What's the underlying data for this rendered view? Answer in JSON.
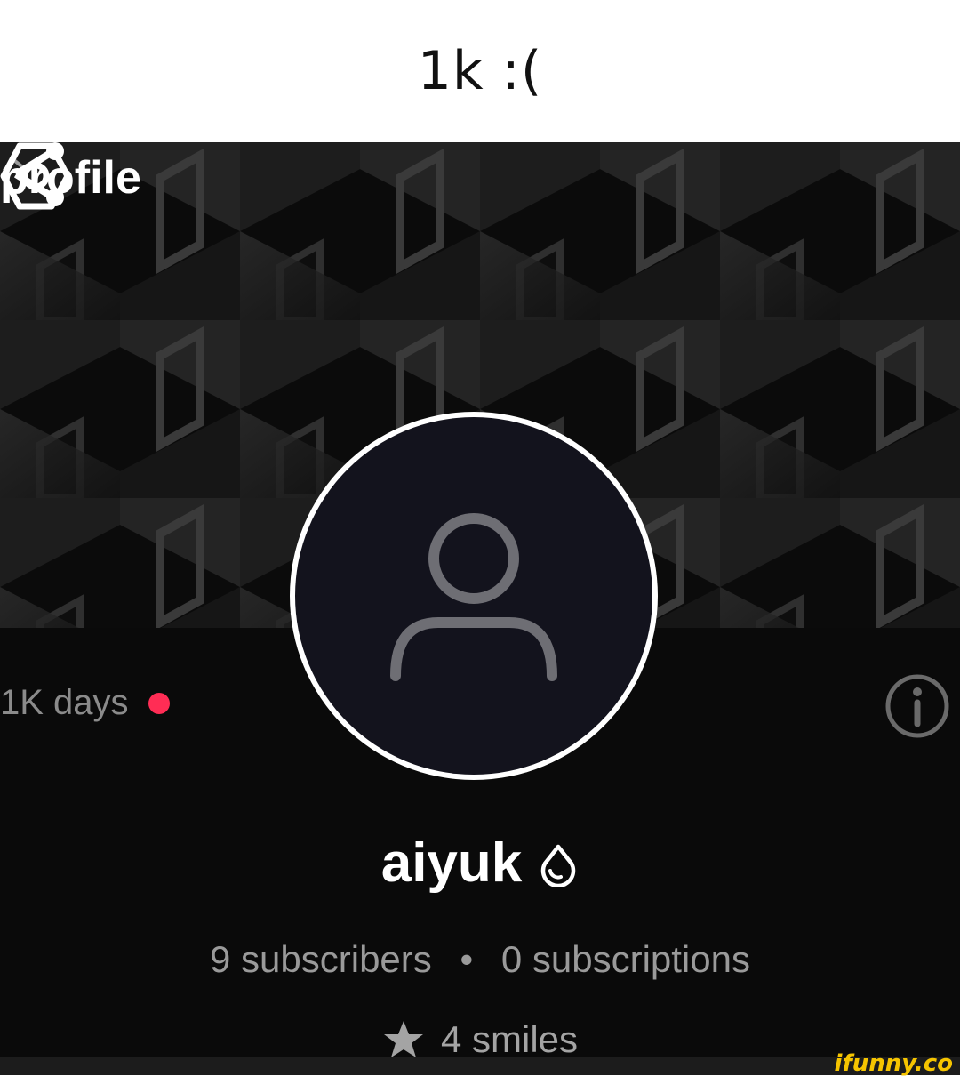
{
  "caption": {
    "text": "1k :("
  },
  "header": {
    "title": "profile"
  },
  "stats_row": {
    "days": "1K days",
    "username": "aiyuk",
    "subscribers": "9 subscribers",
    "separator": "•",
    "subscriptions": "0 subscriptions",
    "smiles": "4 smiles"
  },
  "colors": {
    "background": "#0a0a0a",
    "status_dot": "#ff2d55",
    "avatar_bg": "#13131d",
    "watermark": "#f5c400"
  },
  "icons": {
    "title_dropdown": "chevron-down-icon",
    "share": "share-icon",
    "settings": "settings-icon",
    "avatar": "user-placeholder-icon",
    "info": "info-icon",
    "badge": "droplet-icon",
    "smiles": "star-icon"
  },
  "watermark": {
    "text": "ifunny.co"
  }
}
